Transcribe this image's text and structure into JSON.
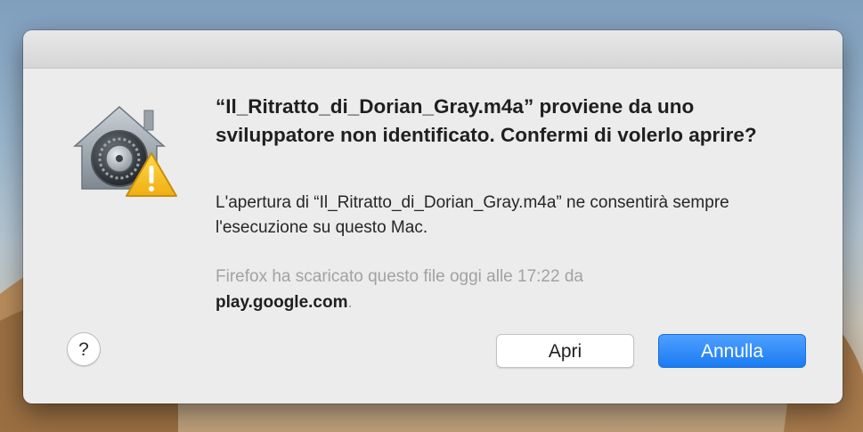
{
  "dialog": {
    "title": "“Il_Ritratto_di_Dorian_Gray.m4a” proviene da uno sviluppatore non identificato. Confermi di volerlo aprire?",
    "description": "L'apertura di “Il_Ritratto_di_Dorian_Gray.m4a” ne consentirà sempre l'esecuzione su questo Mac.",
    "source_prefix": "Firefox ha scaricato questo file oggi alle 17:22 da",
    "source_domain": "play.google.com",
    "source_suffix": ".",
    "icon": "gatekeeper-house-vault-warning-icon",
    "help_label": "?",
    "open_label": "Apri",
    "cancel_label": "Annulla"
  },
  "colors": {
    "accent_button": "#1a7cf2",
    "warning_triangle": "#f7c22b",
    "dialog_background": "#ececec"
  }
}
